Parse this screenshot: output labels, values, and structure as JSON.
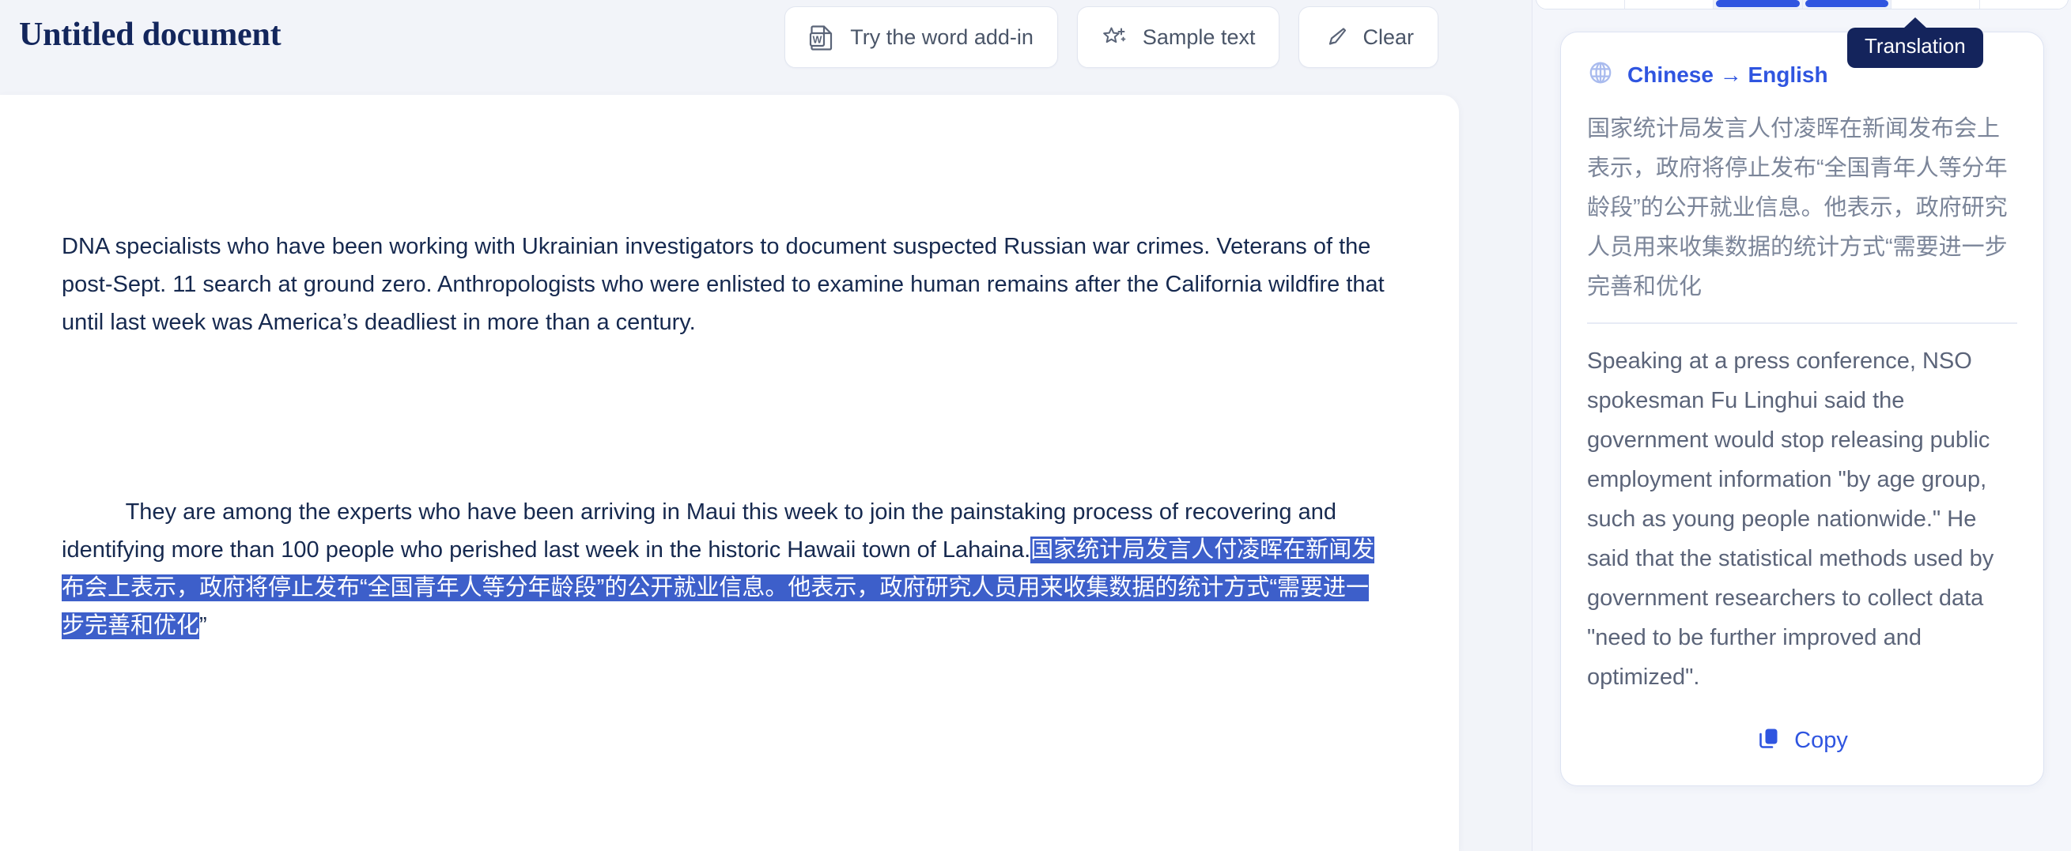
{
  "document": {
    "title": "Untitled document",
    "paragraph_1": "DNA specialists who have been working with Ukrainian investigators to document suspected Russian war crimes. Veterans of the post-Sept. 11 search at ground zero. Anthropologists who were enlisted to examine human remains after the California wildfire that until last week was America’s deadliest in more than a century.",
    "paragraph_2_plain": "They are among the experts who have been arriving in Maui this week to join the painstaking process of recovering and identifying more than 100 people who perished last week in the historic Hawaii town of Lahaina.",
    "paragraph_2_selected": "国家统计局发言人付凌晖在新闻发布会上表示，政府将停止发布“全国青年人等分年龄段”的公开就业信息。他表示，政府研究人员用来收集数据的统计方式“需要进一步完善和优化",
    "paragraph_2_trailing": "”"
  },
  "header": {
    "buttons": [
      {
        "label": "Try the word add-in",
        "icon": "word-document-icon"
      },
      {
        "label": "Sample text",
        "icon": "sparkle-star-icon"
      },
      {
        "label": "Clear",
        "icon": "brush-clear-icon"
      }
    ]
  },
  "right_panel": {
    "tooltip": "Translation",
    "tabs": [
      {
        "label": "",
        "active": false
      },
      {
        "label": "",
        "active": false
      },
      {
        "label": "",
        "active": true
      },
      {
        "label": "",
        "active": true
      },
      {
        "label": "",
        "active": false
      },
      {
        "label": "",
        "active": false
      }
    ],
    "translation_card": {
      "globe_icon": "globe-icon",
      "language_pair": "Chinese → English",
      "source_text": "国家统计局发言人付凌晖在新闻发布会上表示，政府将停止发布“全国青年人等分年龄段”的公开就业信息。他表示，政府研究人员用来收集数据的统计方式“需要进一步完善和优化",
      "target_text": "Speaking at a press conference, NSO spokesman Fu Linghui said the government would stop releasing public employment information \"by age group, such as young people nationwide.\" He said that the statistical methods used by government researchers to collect data \"need to be further improved and optimized\".",
      "copy_label": "Copy",
      "copy_icon": "copy-icon"
    }
  },
  "colors": {
    "accent_blue": "#2f55e0",
    "selection_blue": "#3d5fca",
    "tooltip_navy": "#14245c",
    "title_navy": "#13265c",
    "body_navy": "#16294f",
    "page_bg": "#f2f4f9"
  }
}
